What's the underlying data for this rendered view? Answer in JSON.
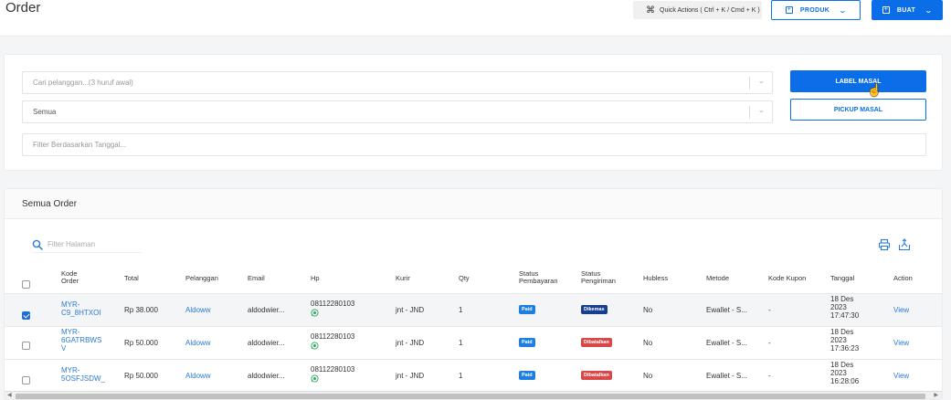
{
  "header": {
    "title": "Order",
    "quick_actions": "Quick Actions ( Ctrl + K / Cmd + K )",
    "produk_label": "PRODUK",
    "buat_label": "BUAT"
  },
  "filters": {
    "pelanggan_placeholder": "Cari pelanggan...(3 huruf awal)",
    "status_value": "Semua",
    "tanggal_placeholder": "Filter Berdasarkan Tanggal...",
    "label_masal": "LABEL MASAL",
    "pickup_masal": "PICKUP MASAL"
  },
  "orders": {
    "title": "Semua Order",
    "search_placeholder": "Filter Halaman",
    "columns": {
      "kode_line1": "Kode",
      "kode_line2": "Order",
      "total": "Total",
      "pelanggan": "Pelanggan",
      "email": "Email",
      "hp": "Hp",
      "kurir": "Kurir",
      "qty": "Qty",
      "pembayaran_line1": "Status",
      "pembayaran_line2": "Pembayaran",
      "pengiriman_line1": "Status",
      "pengiriman_line2": "Pengiriman",
      "hubless": "Hubless",
      "metode": "Metode",
      "kupon": "Kode Kupon",
      "tanggal": "Tanggal",
      "action": "Action"
    },
    "rows": [
      {
        "checked": true,
        "kode": [
          "MYR-",
          "C9_8HTXOI"
        ],
        "total": "Rp 38.000",
        "pelanggan": "Aldoww",
        "email": "aldodwier...",
        "hp": "08112280103",
        "kurir": "jnt - JND",
        "qty": "1",
        "pembayaran": "Paid",
        "pengiriman": "Dikemas",
        "hubless": "No",
        "metode": "Ewallet - S...",
        "kupon": "-",
        "tanggal": [
          "18 Des",
          "2023",
          "17:47:30"
        ],
        "action": "View"
      },
      {
        "checked": false,
        "kode": [
          "MYR-",
          "6GATRBWS",
          "V"
        ],
        "total": "Rp 50.000",
        "pelanggan": "Aldoww",
        "email": "aldodwier...",
        "hp": "08112280103",
        "kurir": "jnt - JND",
        "qty": "1",
        "pembayaran": "Paid",
        "pengiriman": "Dibatalkan",
        "hubless": "No",
        "metode": "Ewallet - S...",
        "kupon": "-",
        "tanggal": [
          "18 Des",
          "2023",
          "17:36:23"
        ],
        "action": "View"
      },
      {
        "checked": false,
        "kode": [
          "MYR-",
          "5OSFJSDW_"
        ],
        "total": "Rp 50.000",
        "pelanggan": "Aldoww",
        "email": "aldodwier...",
        "hp": "08112280103",
        "kurir": "jnt - JND",
        "qty": "1",
        "pembayaran": "Paid",
        "pengiriman": "Dibatalkan",
        "hubless": "No",
        "metode": "Ewallet - S...",
        "kupon": "-",
        "tanggal": [
          "18 Des",
          "2023",
          "16:28:06"
        ],
        "action": "View"
      }
    ]
  },
  "colors": {
    "primary": "#0b6ee8",
    "paid": "#1f7fe0",
    "dikemas": "#163f8f",
    "dibatalkan": "#d94848",
    "link": "#2a7ad6",
    "whatsapp": "#25a55a"
  },
  "icons": {
    "quick_actions": "command-icon",
    "produk": "plus-square-icon",
    "buat": "plus-square-icon",
    "search": "search-icon",
    "print": "printer-icon",
    "export": "export-icon",
    "phone": "whatsapp-icon"
  }
}
